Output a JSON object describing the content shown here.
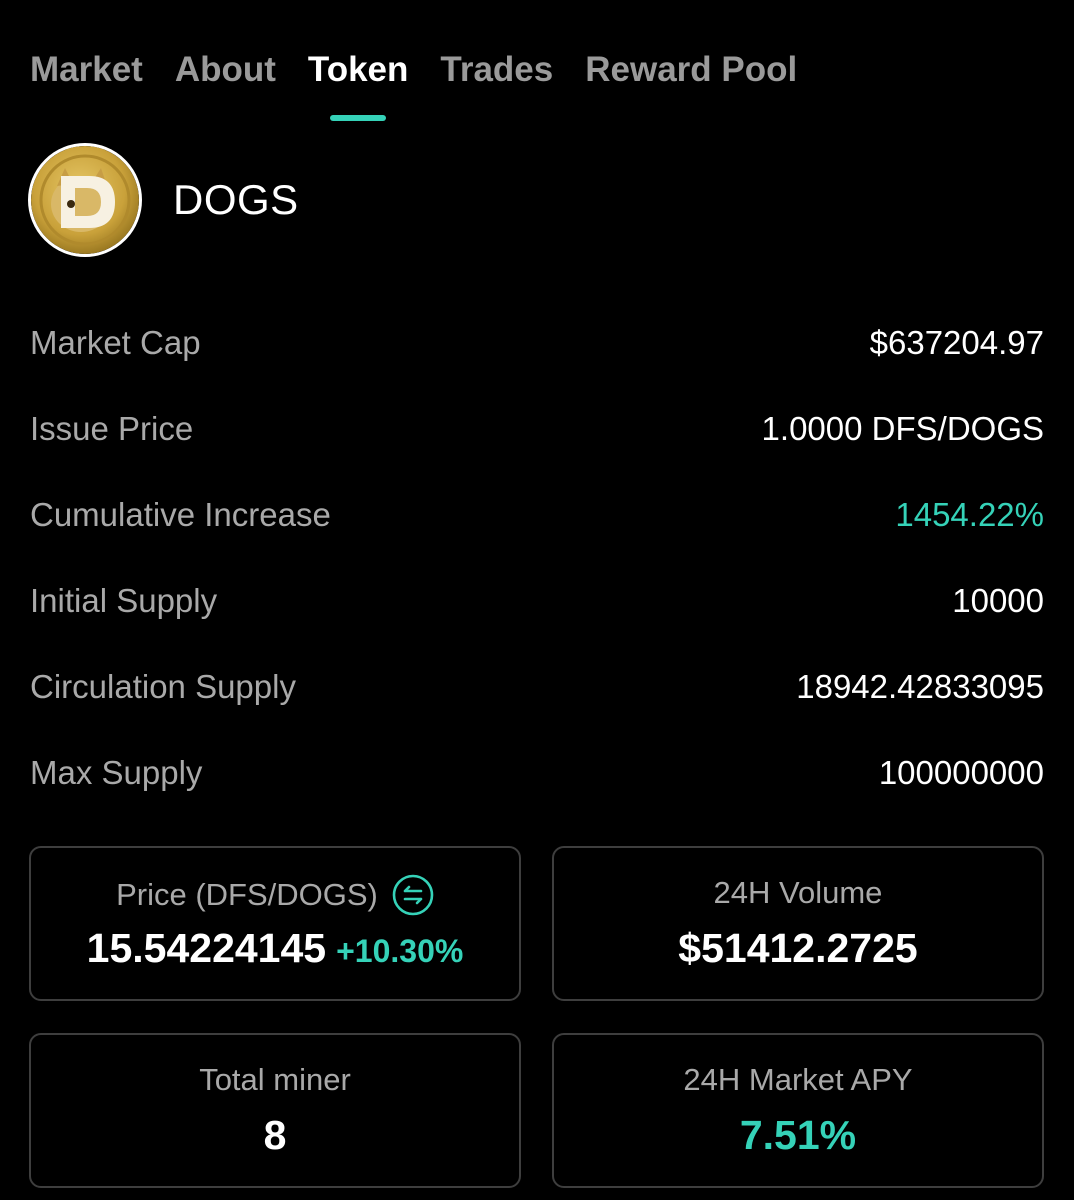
{
  "tabs": [
    {
      "label": "Market"
    },
    {
      "label": "About"
    },
    {
      "label": "Token"
    },
    {
      "label": "Trades"
    },
    {
      "label": "Reward Pool"
    }
  ],
  "active_tab": "Token",
  "token": {
    "name": "DOGS",
    "logo_icon": "doge-coin-icon"
  },
  "info_rows": [
    {
      "label": "Market Cap",
      "value": "$637204.97"
    },
    {
      "label": "Issue Price",
      "value": "1.0000 DFS/DOGS"
    },
    {
      "label": "Cumulative Increase",
      "value": "1454.22%"
    },
    {
      "label": "Initial Supply",
      "value": "10000"
    },
    {
      "label": "Circulation Supply",
      "value": "18942.42833095"
    },
    {
      "label": "Max Supply",
      "value": "100000000"
    }
  ],
  "cards": {
    "price": {
      "title": "Price (DFS/DOGS)",
      "value": "15.54224145",
      "change": "+10.30%",
      "icon": "swap-icon"
    },
    "volume": {
      "title": "24H Volume",
      "value": "$51412.2725"
    },
    "miner": {
      "title": "Total miner",
      "value": "8"
    },
    "apy": {
      "title": "24H Market APY",
      "value": "7.51%"
    }
  },
  "colors": {
    "accent": "#35d2b8",
    "background": "#000000",
    "label": "#a9a9a9",
    "card_border": "#3e3e3e"
  }
}
